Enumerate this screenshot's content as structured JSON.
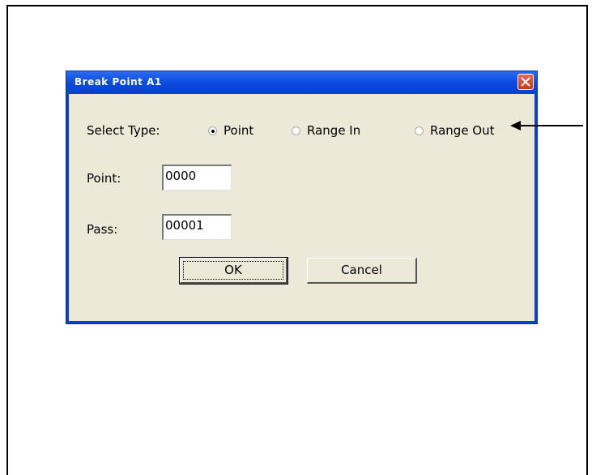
{
  "dialog": {
    "title": "Break Point A1",
    "select_type_label": "Select Type:",
    "radio_options": [
      {
        "label": "Point",
        "selected": true
      },
      {
        "label": "Range In",
        "selected": false
      },
      {
        "label": "Range Out",
        "selected": false
      }
    ],
    "point_label": "Point:",
    "point_value": "0000",
    "pass_label": "Pass:",
    "pass_value": "00001",
    "ok_label": "OK",
    "cancel_label": "Cancel"
  },
  "colors": {
    "titlebar": "#0a4be0",
    "client_bg": "#ece9d8",
    "close_button": "#d9482b"
  },
  "icons": {
    "close": "close-icon",
    "arrow": "arrow-left-icon"
  }
}
